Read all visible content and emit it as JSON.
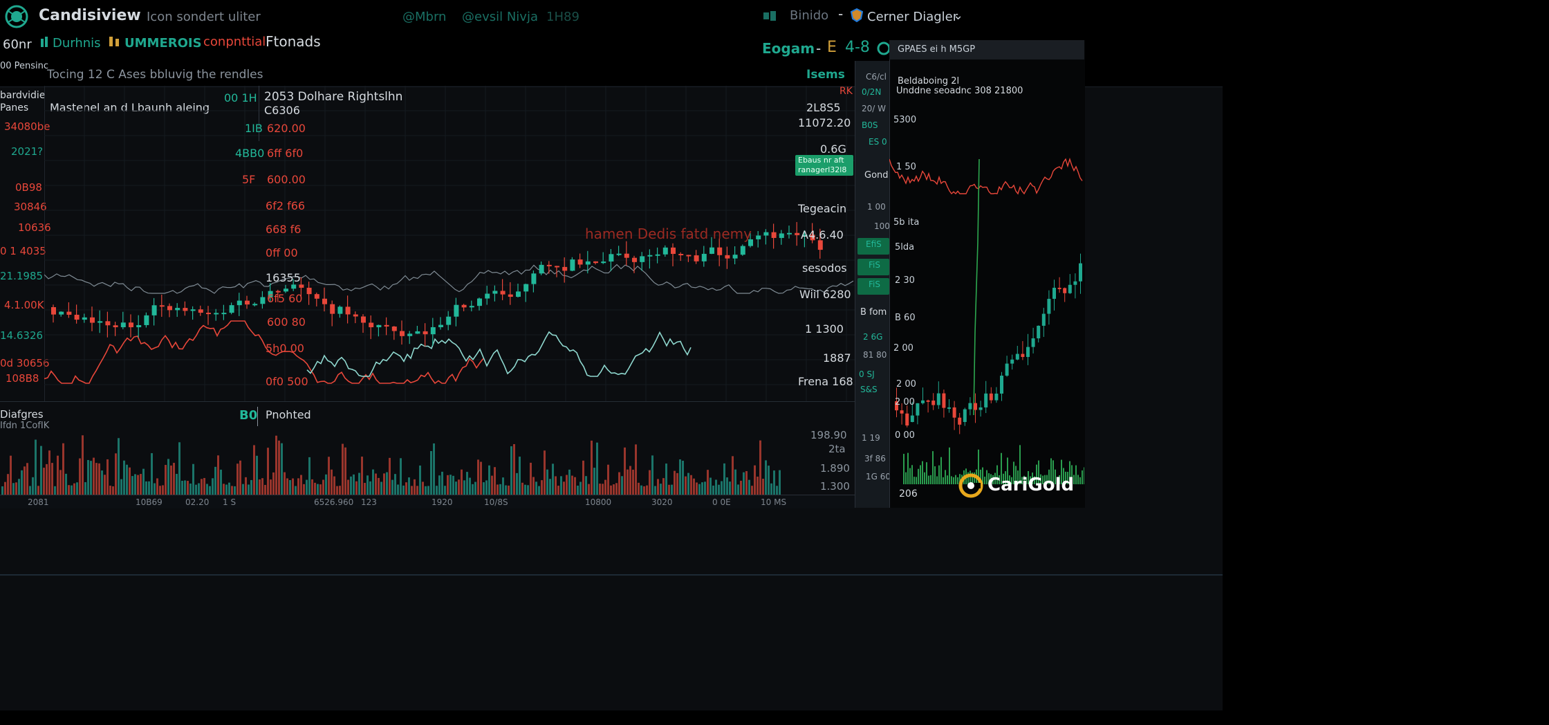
{
  "app": {
    "name": "Candisiview",
    "nav": [
      "Icon sondert uliter"
    ],
    "center_tabs": [
      "@Mbrn",
      "@evsil Nivja",
      "1H89"
    ],
    "right": {
      "item1": "Binido",
      "item2": "Cerner Diagler"
    }
  },
  "toolbar": {
    "items": [
      {
        "label": "60nr",
        "color": "#d6dbe0"
      },
      {
        "label": "Durhnis",
        "color": "#1fa88f"
      },
      {
        "label": "UMMEROIS",
        "color": "#1fa88f"
      },
      {
        "label": "conpnttial",
        "color": "#e8473a"
      },
      {
        "label": "Ftonads",
        "color": "#d6dbe0"
      }
    ],
    "right": {
      "login": "Eogam",
      "b": "E",
      "c": "4-8"
    }
  },
  "main": {
    "header": "Tocing 12 C Ases bbluvig the rendles",
    "header_right": "Isems",
    "left_top": "00 Pensinc",
    "left_labels": [
      {
        "text": "bardvidie\nPanes",
        "color": "#d6dbe0"
      },
      {
        "text": "34080be",
        "color": "#e8473a"
      },
      {
        "text": "2021?",
        "color": "#1fa88f"
      },
      {
        "text": "0B98",
        "color": "#e8473a"
      },
      {
        "text": "30846",
        "color": "#e8473a"
      },
      {
        "text": "10636",
        "color": "#e8473a"
      },
      {
        "text": "0 1 4035",
        "color": "#e8473a"
      },
      {
        "text": "21.1985",
        "color": "#1fa88f"
      },
      {
        "text": "4.1.00K",
        "color": "#e8473a"
      },
      {
        "text": "14.6326",
        "color": "#1fa88f"
      },
      {
        "text": "0d 30656",
        "color": "#e8473a"
      },
      {
        "text": "108B8",
        "color": "#e8473a"
      }
    ],
    "legend_title": "Mastenel an d Lbaunh aleing",
    "overlay_prices": [
      {
        "label": "00 1H",
        "color": "#22b89a"
      },
      {
        "label": "1IB",
        "color": "#22b89a"
      },
      {
        "label": "4BB0",
        "color": "#22b89a"
      },
      {
        "label": "5F",
        "color": "#e8473a"
      }
    ],
    "info_box": {
      "title": "2053  Dolhare Rightslhn",
      "sub": "C6306"
    },
    "axis_labels": [
      {
        "text": "620.00",
        "color": "#e8473a"
      },
      {
        "text": "6ff 6f0",
        "color": "#e8473a"
      },
      {
        "text": "600.00",
        "color": "#e8473a"
      },
      {
        "text": "6f2 f66",
        "color": "#e8473a"
      },
      {
        "text": "668 f6",
        "color": "#e8473a"
      },
      {
        "text": "0ff 00",
        "color": "#e8473a"
      },
      {
        "text": "16355",
        "color": "#d6dbe0"
      },
      {
        "text": "6f5 60",
        "color": "#e8473a"
      },
      {
        "text": "600 80",
        "color": "#e8473a"
      },
      {
        "text": "5h0 00",
        "color": "#e8473a"
      },
      {
        "text": "0f0 500",
        "color": "#e8473a"
      }
    ],
    "watermark": "hamen Dedis fatd nemy",
    "right_axis": [
      {
        "text": "2L8S5",
        "color": "#d6dbe0"
      },
      {
        "text": "11072.20",
        "color": "#d6dbe0"
      },
      {
        "text": "0.6G",
        "color": "#d6dbe0"
      },
      {
        "text": "Tegeacin",
        "color": "#d6dbe0"
      },
      {
        "text": "A4.6.40",
        "color": "#d6dbe0"
      },
      {
        "text": "sesodos",
        "color": "#d6dbe0"
      },
      {
        "text": "Wiil 6280",
        "color": "#d6dbe0"
      },
      {
        "text": "1 1300",
        "color": "#d6dbe0"
      },
      {
        "text": "1887",
        "color": "#d6dbe0"
      },
      {
        "text": "Frena 168",
        "color": "#d6dbe0"
      }
    ],
    "tooltip": {
      "line1": "Ebaus nr aft",
      "line2": "ranagerl32l8"
    },
    "rk": "RK"
  },
  "volume": {
    "label1": "Diafgres",
    "label2": "Ifdn 1CofIK",
    "badge": "B0",
    "title": "Pnohted",
    "axis": [
      "198.90",
      "2ta",
      "1.890",
      "1.300"
    ],
    "bottom_axis": [
      "2081",
      "10B69",
      "02.20",
      "1 S",
      "6526.960",
      "123",
      "1920",
      "10/8S",
      "10800",
      "3020",
      "0 0E",
      "10 MS"
    ]
  },
  "rightcol": {
    "items": [
      {
        "text": "C6/cl",
        "color": "#9aa3ad"
      },
      {
        "text": "0/2N",
        "color": "#22b89a"
      },
      {
        "text": "20/ W",
        "color": "#9aa3ad"
      },
      {
        "text": "B0S",
        "color": "#22b89a"
      },
      {
        "text": "ES 0",
        "color": "#22b89a"
      },
      {
        "text": "Gond",
        "color": "#d6dbe0"
      },
      {
        "text": "1 00",
        "color": "#9aa3ad"
      },
      {
        "text": "100",
        "color": "#9aa3ad"
      },
      {
        "text": "EfiS",
        "color": "#22b89a"
      },
      {
        "text": "FiS",
        "color": "#22b89a"
      },
      {
        "text": "FiS",
        "color": "#22b89a"
      },
      {
        "text": "B fom",
        "color": "#d6dbe0"
      },
      {
        "text": "2 6G",
        "color": "#22b89a"
      },
      {
        "text": "81 80",
        "color": "#9aa3ad"
      },
      {
        "text": "0 SJ",
        "color": "#22b89a"
      },
      {
        "text": "S&S",
        "color": "#22b89a"
      },
      {
        "text": "1 19",
        "color": "#9aa3ad"
      },
      {
        "text": "3f 86",
        "color": "#9aa3ad"
      },
      {
        "text": "1G 60",
        "color": "#9aa3ad"
      }
    ]
  },
  "side": {
    "header": "GPAES ei h M5GP",
    "sub1": "Beldaboing 2l",
    "sub2": "Unddne seoadnc 308 21800",
    "labels": [
      "5300",
      "1 50",
      "5b ita",
      "5lda",
      "2 30",
      "B 60",
      "2 00",
      "2 00",
      "0 00",
      "2 00"
    ],
    "bottom": "206"
  },
  "logo": {
    "brand": "CariGold"
  },
  "colors": {
    "up": "#22b89a",
    "down": "#e8473a",
    "bg": "#000000",
    "panel": "#0b0d10"
  }
}
